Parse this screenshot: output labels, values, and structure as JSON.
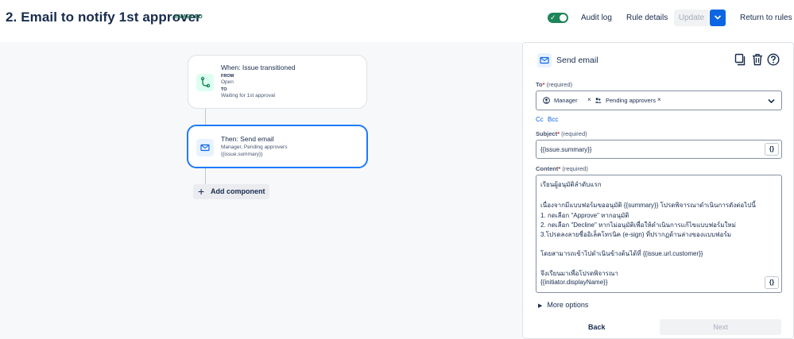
{
  "header": {
    "title": "2. Email to notify 1st approver",
    "status_badge": "ENABLED",
    "audit_log": "Audit log",
    "rule_details": "Rule details",
    "update": "Update",
    "return": "Return to rules"
  },
  "canvas": {
    "trigger": {
      "title": "When: Issue transitioned",
      "from_label": "FROM",
      "from_value": "Open",
      "to_label": "TO",
      "to_value": "Waiting for 1st approval"
    },
    "action": {
      "title": "Then: Send email",
      "recipients": "Manager, Pending approvers",
      "subject": "{{issue.summary}}"
    },
    "add_component": "Add component"
  },
  "panel": {
    "title": "Send email",
    "to_label": "To",
    "to_required": "(required)",
    "to_chips": [
      "Manager",
      "Pending approvers"
    ],
    "cc": "Cc",
    "bcc": "Bcc",
    "subject_label": "Subject",
    "subject_required": "(required)",
    "subject_value": "{{issue.summary}}",
    "content_label": "Content",
    "content_required": "(required)",
    "content_lines": [
      "เรียนผู้อนุมัติลำดับแรก",
      "",
      "เนื่องจากมีแบบฟอร์มขออนุมัติ {{summary}} โปรดพิจารณาดำเนินการดังต่อไปนี้",
      "1. กดเลือก \"Approve\" หากอนุมัติ",
      "2. กดเลือก \"Decline\" หากไม่อนุมัติเพื่อให้ดำเนินการแก้ไขแบบฟอร์มใหม่",
      "3.โปรดลงลายชื่ออิเล็คโทรนิค (e-sign) ที่ปรากฏด้านล่างของแบบฟอร์ม",
      "",
      "โดยสามารถเข้าไปดำเนินข้างต้นได้ที่ {{issue.url.customer}}",
      "",
      "จึงเรียนมาเพื่อโปรดพิจารณา",
      "{{initiator.displayName}}"
    ],
    "braces": "{}",
    "more_options": "More options",
    "back": "Back",
    "next": "Next"
  },
  "colors": {
    "accent": "#0c66e4",
    "toggle_on": "#1f845a",
    "selected_border": "#1d7afc",
    "canvas_bg": "#f7f8f9"
  }
}
